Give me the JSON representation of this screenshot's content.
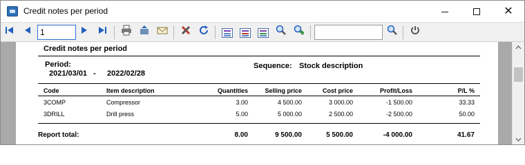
{
  "window": {
    "title": "Credit notes per period",
    "minimize_glyph": "",
    "maximize_glyph": "",
    "close_glyph": "✕"
  },
  "toolbar": {
    "page_number": "1",
    "search_value": "",
    "icons": [
      "first-page-icon",
      "prev-page-icon",
      "next-page-icon",
      "last-page-icon",
      "print-icon",
      "export-icon",
      "email-icon",
      "tools-icon",
      "refresh-icon",
      "layout1-icon",
      "layout2-icon",
      "layout3-icon",
      "zoom-icon",
      "zoom-in-icon",
      "search-icon",
      "power-icon"
    ]
  },
  "report": {
    "title": "Credit notes per period",
    "period_label": "Period:",
    "period_from": "2021/03/01",
    "period_sep": "-",
    "period_to": "2022/02/28",
    "sequence_label": "Sequence:",
    "sequence_value": "Stock description",
    "columns": {
      "code": "Code",
      "description": "Item description",
      "quantities": "Quantities",
      "selling_price": "Selling price",
      "cost_price": "Cost price",
      "profit_loss": "Profit/Loss",
      "pl_percent": "P/L %"
    },
    "rows": [
      {
        "code": "3COMP",
        "description": "Compressor",
        "quantities": "3.00",
        "selling_price": "4 500.00",
        "cost_price": "3 000.00",
        "profit_loss": "-1 500.00",
        "pl_percent": "33.33"
      },
      {
        "code": "3DRILL",
        "description": "Drill press",
        "quantities": "5.00",
        "selling_price": "5 000.00",
        "cost_price": "2 500.00",
        "profit_loss": "-2 500.00",
        "pl_percent": "50.00"
      }
    ],
    "total": {
      "label": "Report total:",
      "quantities": "8.00",
      "selling_price": "9 500.00",
      "cost_price": "5 500.00",
      "profit_loss": "-4 000.00",
      "pl_percent": "41.67"
    }
  },
  "colors": {
    "accent": "#1f5fbf",
    "gutter": "#a9a9a9",
    "toolbar_bg": "#f0f0f0"
  }
}
